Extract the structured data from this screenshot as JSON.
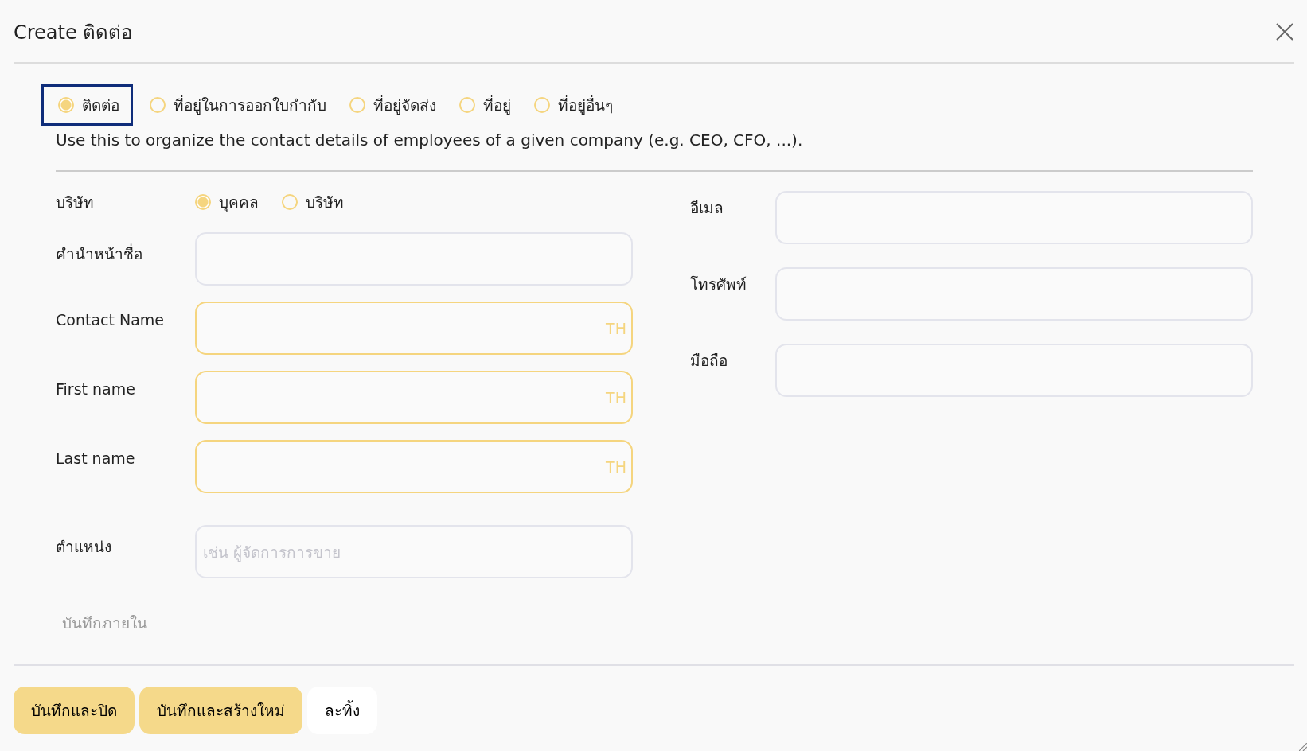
{
  "dialog": {
    "title": "Create ติดต่อ"
  },
  "address_types": [
    {
      "label": "ติดต่อ",
      "selected": true,
      "focused": true
    },
    {
      "label": "ที่อยู่ในการออกใบกำกับ",
      "selected": false,
      "focused": false
    },
    {
      "label": "ที่อยู่จัดส่ง",
      "selected": false,
      "focused": false
    },
    {
      "label": "ที่อยู่",
      "selected": false,
      "focused": false
    },
    {
      "label": "ที่อยู่อื่นๆ",
      "selected": false,
      "focused": false
    }
  ],
  "description": "Use this to organize the contact details of employees of a given company (e.g. CEO, CFO, ...).",
  "company_type": {
    "label": "บริษัท",
    "options": [
      {
        "label": "บุคคล",
        "selected": true
      },
      {
        "label": "บริษัท",
        "selected": false
      }
    ]
  },
  "left_fields": [
    {
      "label": "คำนำหน้าชื่อ",
      "translatable": false
    },
    {
      "label": "Contact Name",
      "translatable": true,
      "lang_badge": "TH"
    },
    {
      "label": "First name",
      "translatable": true,
      "lang_badge": "TH"
    },
    {
      "label": "Last name",
      "translatable": true,
      "lang_badge": "TH"
    },
    {
      "label": "ตำแหน่ง",
      "translatable": false,
      "placeholder": "เช่น ผู้จัดการการขาย"
    }
  ],
  "right_fields": [
    {
      "label": "อีเมล"
    },
    {
      "label": "โทรศัพท์"
    },
    {
      "label": "มือถือ"
    }
  ],
  "internal_notes": {
    "placeholder": "บันทึกภายใน"
  },
  "buttons": [
    {
      "label": "บันทึกและปิด",
      "kind": "primary"
    },
    {
      "label": "บันทึกและสร้างใหม่",
      "kind": "primary"
    },
    {
      "label": "ละทิ้ง",
      "kind": "secondary"
    }
  ]
}
